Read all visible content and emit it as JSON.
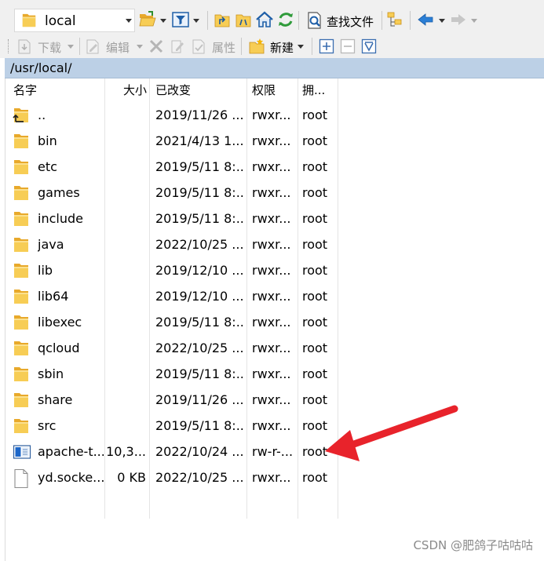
{
  "toolbar": {
    "location": "local",
    "find_files": "查找文件"
  },
  "toolbar2": {
    "download": "下载",
    "edit": "编辑",
    "properties": "属性",
    "new": "新建"
  },
  "current_path": "/usr/local/",
  "columns": {
    "name": "名字",
    "size": "大小",
    "modified": "已改变",
    "permissions": "权限",
    "owner": "拥..."
  },
  "files": [
    {
      "name": "..",
      "size": "",
      "modified": "2019/11/26 ...",
      "permissions": "rwxr...",
      "owner": "root",
      "icon": "parent-folder-icon"
    },
    {
      "name": "bin",
      "size": "",
      "modified": "2021/4/13 1...",
      "permissions": "rwxr...",
      "owner": "root",
      "icon": "folder-icon"
    },
    {
      "name": "etc",
      "size": "",
      "modified": "2019/5/11 8:...",
      "permissions": "rwxr...",
      "owner": "root",
      "icon": "folder-icon"
    },
    {
      "name": "games",
      "size": "",
      "modified": "2019/5/11 8:...",
      "permissions": "rwxr...",
      "owner": "root",
      "icon": "folder-icon"
    },
    {
      "name": "include",
      "size": "",
      "modified": "2019/5/11 8:...",
      "permissions": "rwxr...",
      "owner": "root",
      "icon": "folder-icon"
    },
    {
      "name": "java",
      "size": "",
      "modified": "2022/10/25 ...",
      "permissions": "rwxr...",
      "owner": "root",
      "icon": "folder-icon"
    },
    {
      "name": "lib",
      "size": "",
      "modified": "2019/12/10 ...",
      "permissions": "rwxr...",
      "owner": "root",
      "icon": "folder-icon"
    },
    {
      "name": "lib64",
      "size": "",
      "modified": "2019/12/10 ...",
      "permissions": "rwxr...",
      "owner": "root",
      "icon": "folder-icon"
    },
    {
      "name": "libexec",
      "size": "",
      "modified": "2019/5/11 8:...",
      "permissions": "rwxr...",
      "owner": "root",
      "icon": "folder-icon"
    },
    {
      "name": "qcloud",
      "size": "",
      "modified": "2022/10/25 ...",
      "permissions": "rwxr...",
      "owner": "root",
      "icon": "folder-icon"
    },
    {
      "name": "sbin",
      "size": "",
      "modified": "2019/5/11 8:...",
      "permissions": "rwxr...",
      "owner": "root",
      "icon": "folder-icon"
    },
    {
      "name": "share",
      "size": "",
      "modified": "2019/11/26 ...",
      "permissions": "rwxr...",
      "owner": "root",
      "icon": "folder-icon"
    },
    {
      "name": "src",
      "size": "",
      "modified": "2019/5/11 8:...",
      "permissions": "rwxr...",
      "owner": "root",
      "icon": "folder-icon"
    },
    {
      "name": "apache-t...",
      "size": "10,3...",
      "modified": "2022/10/24 ...",
      "permissions": "rw-r-...",
      "owner": "root",
      "icon": "archive-file-icon"
    },
    {
      "name": "yd.socke...",
      "size": "0 KB",
      "modified": "2022/10/25 ...",
      "permissions": "rwxr...",
      "owner": "root",
      "icon": "blank-file-icon"
    }
  ],
  "watermark": "CSDN @肥鸽子咕咕咕",
  "colors": {
    "path_bar": "#bcd0e6",
    "folder": "#f2c14e",
    "annotation_arrow": "#e8232b"
  }
}
